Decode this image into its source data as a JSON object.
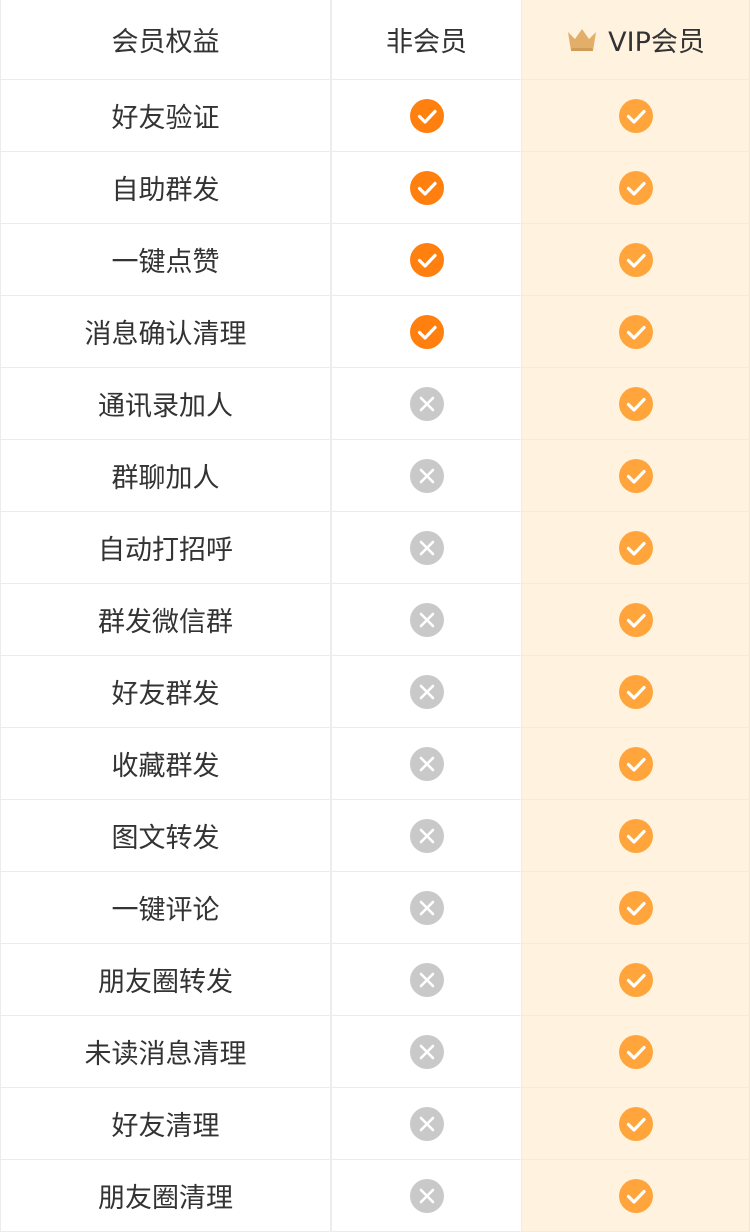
{
  "header": {
    "col_feature": "会员权益",
    "col_nonmember": "非会员",
    "col_vip": "VIP会员",
    "crown_icon": "crown-icon"
  },
  "colors": {
    "check_strong": "#ff7f0f",
    "check_soft": "#ffa53b",
    "cross_gray": "#c9c9c9",
    "vip_bg": "#fff3e0",
    "crown_gold": "#e3ae6a"
  },
  "rows": [
    {
      "feature": "好友验证",
      "nonmember": "check",
      "vip": "check"
    },
    {
      "feature": "自助群发",
      "nonmember": "check",
      "vip": "check"
    },
    {
      "feature": "一键点赞",
      "nonmember": "check",
      "vip": "check"
    },
    {
      "feature": "消息确认清理",
      "nonmember": "check",
      "vip": "check"
    },
    {
      "feature": "通讯录加人",
      "nonmember": "cross",
      "vip": "check"
    },
    {
      "feature": "群聊加人",
      "nonmember": "cross",
      "vip": "check"
    },
    {
      "feature": "自动打招呼",
      "nonmember": "cross",
      "vip": "check"
    },
    {
      "feature": "群发微信群",
      "nonmember": "cross",
      "vip": "check"
    },
    {
      "feature": "好友群发",
      "nonmember": "cross",
      "vip": "check"
    },
    {
      "feature": "收藏群发",
      "nonmember": "cross",
      "vip": "check"
    },
    {
      "feature": "图文转发",
      "nonmember": "cross",
      "vip": "check"
    },
    {
      "feature": "一键评论",
      "nonmember": "cross",
      "vip": "check"
    },
    {
      "feature": "朋友圈转发",
      "nonmember": "cross",
      "vip": "check"
    },
    {
      "feature": "未读消息清理",
      "nonmember": "cross",
      "vip": "check"
    },
    {
      "feature": "好友清理",
      "nonmember": "cross",
      "vip": "check"
    },
    {
      "feature": "朋友圈清理",
      "nonmember": "cross",
      "vip": "check"
    }
  ]
}
